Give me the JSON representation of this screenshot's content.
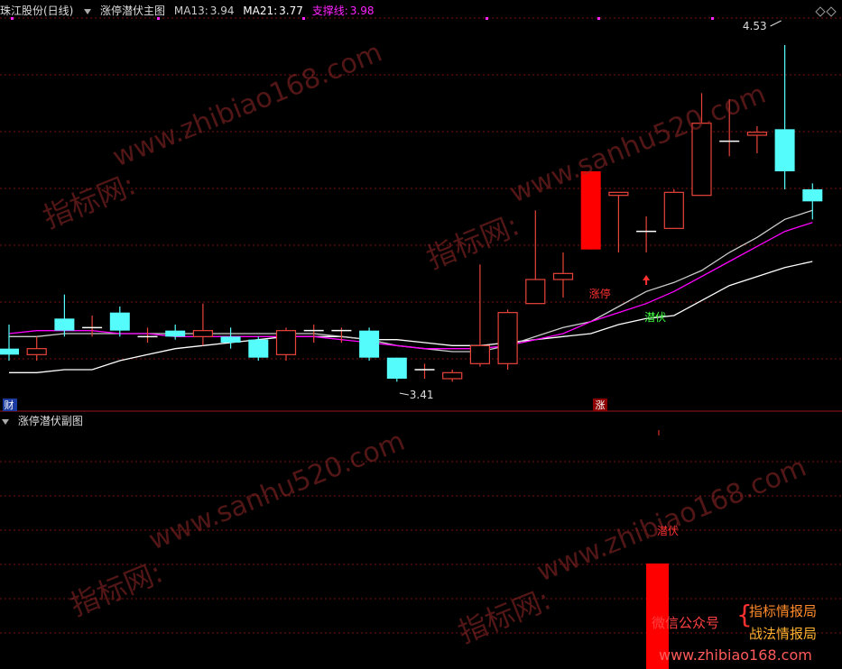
{
  "main_header": {
    "stock": "珠江股份(日线)",
    "indicator": "涨停潜伏主图",
    "ma13_label": "MA13:",
    "ma13_value": "3.94",
    "ma21_label": "MA21:",
    "ma21_value": "3.77",
    "support_label": "支撑线:",
    "support_value": "3.98"
  },
  "sub_header": {
    "indicator": "涨停潜伏副图"
  },
  "chart_data": {
    "type": "candlestick",
    "high_label": "4.53",
    "low_label": "3.41",
    "candles": [
      {
        "o": 3.52,
        "h": 3.6,
        "l": 3.48,
        "c": 3.5
      },
      {
        "o": 3.5,
        "h": 3.56,
        "l": 3.48,
        "c": 3.52
      },
      {
        "o": 3.62,
        "h": 3.7,
        "l": 3.56,
        "c": 3.58
      },
      {
        "o": 3.59,
        "h": 3.63,
        "l": 3.56,
        "c": 3.59
      },
      {
        "o": 3.64,
        "h": 3.66,
        "l": 3.56,
        "c": 3.58
      },
      {
        "o": 3.56,
        "h": 3.59,
        "l": 3.54,
        "c": 3.56
      },
      {
        "o": 3.58,
        "h": 3.6,
        "l": 3.55,
        "c": 3.56
      },
      {
        "o": 3.56,
        "h": 3.67,
        "l": 3.53,
        "c": 3.58
      },
      {
        "o": 3.56,
        "h": 3.59,
        "l": 3.52,
        "c": 3.54
      },
      {
        "o": 3.55,
        "h": 3.56,
        "l": 3.48,
        "c": 3.49
      },
      {
        "o": 3.5,
        "h": 3.59,
        "l": 3.48,
        "c": 3.58
      },
      {
        "o": 3.58,
        "h": 3.6,
        "l": 3.54,
        "c": 3.58
      },
      {
        "o": 3.58,
        "h": 3.59,
        "l": 3.54,
        "c": 3.58
      },
      {
        "o": 3.58,
        "h": 3.59,
        "l": 3.48,
        "c": 3.49
      },
      {
        "o": 3.49,
        "h": 3.49,
        "l": 3.41,
        "c": 3.42
      },
      {
        "o": 3.45,
        "h": 3.47,
        "l": 3.42,
        "c": 3.45
      },
      {
        "o": 3.42,
        "h": 3.45,
        "l": 3.41,
        "c": 3.44
      },
      {
        "o": 3.47,
        "h": 3.8,
        "l": 3.46,
        "c": 3.53
      },
      {
        "o": 3.47,
        "h": 3.65,
        "l": 3.45,
        "c": 3.64
      },
      {
        "o": 3.67,
        "h": 3.98,
        "l": 3.67,
        "c": 3.75
      },
      {
        "o": 3.75,
        "h": 3.84,
        "l": 3.69,
        "c": 3.77
      },
      {
        "o": 3.85,
        "h": 4.11,
        "l": 3.85,
        "c": 4.11
      },
      {
        "o": 4.03,
        "h": 4.04,
        "l": 3.84,
        "c": 4.04
      },
      {
        "o": 3.91,
        "h": 3.96,
        "l": 3.84,
        "c": 3.91
      },
      {
        "o": 3.92,
        "h": 4.05,
        "l": 3.92,
        "c": 4.04
      },
      {
        "o": 4.03,
        "h": 4.37,
        "l": 4.03,
        "c": 4.27
      },
      {
        "o": 4.21,
        "h": 4.35,
        "l": 4.16,
        "c": 4.21
      },
      {
        "o": 4.23,
        "h": 4.26,
        "l": 4.17,
        "c": 4.24
      },
      {
        "o": 4.25,
        "h": 4.53,
        "l": 4.05,
        "c": 4.11
      },
      {
        "o": 4.05,
        "h": 4.07,
        "l": 3.95,
        "c": 4.01
      }
    ],
    "ma13": [
      3.56,
      3.56,
      3.57,
      3.57,
      3.57,
      3.57,
      3.57,
      3.57,
      3.57,
      3.57,
      3.57,
      3.57,
      3.56,
      3.55,
      3.53,
      3.52,
      3.51,
      3.51,
      3.53,
      3.56,
      3.59,
      3.61,
      3.66,
      3.71,
      3.74,
      3.78,
      3.84,
      3.89,
      3.95,
      3.98
    ],
    "ma21": [
      3.57,
      3.58,
      3.58,
      3.58,
      3.57,
      3.57,
      3.56,
      3.56,
      3.56,
      3.56,
      3.56,
      3.56,
      3.55,
      3.54,
      3.53,
      3.52,
      3.52,
      3.52,
      3.53,
      3.55,
      3.57,
      3.61,
      3.64,
      3.67,
      3.71,
      3.76,
      3.81,
      3.86,
      3.91,
      3.94
    ],
    "support": [
      3.44,
      3.44,
      3.45,
      3.45,
      3.48,
      3.5,
      3.52,
      3.53,
      3.54,
      3.55,
      3.56,
      3.56,
      3.56,
      3.55,
      3.55,
      3.54,
      3.53,
      3.53,
      3.54,
      3.55,
      3.56,
      3.57,
      3.6,
      3.62,
      3.63,
      3.68,
      3.73,
      3.76,
      3.79,
      3.81
    ],
    "ylim": [
      3.36,
      4.62
    ],
    "signals": {
      "zhangting_label": "涨停",
      "qianfu_label": "潜伏",
      "marker_char": "涨",
      "cai_label": "财"
    },
    "sub_signal_label": "潜伏",
    "colors": {
      "up": "#e8443a",
      "down": "#54fcfc",
      "ma13": "#cccccc",
      "ma21": "#ff00ff",
      "support": "#ffffff",
      "signal_bar": "#ff0000"
    }
  },
  "watermarks": [
    "www.zhibiao168.com",
    "www.sanhu520.com",
    "指标网:"
  ],
  "promo": {
    "left": "微信公众号",
    "right1": "指标情报局",
    "right2": "战法情报局",
    "url": "www.zhibiao168.com"
  }
}
